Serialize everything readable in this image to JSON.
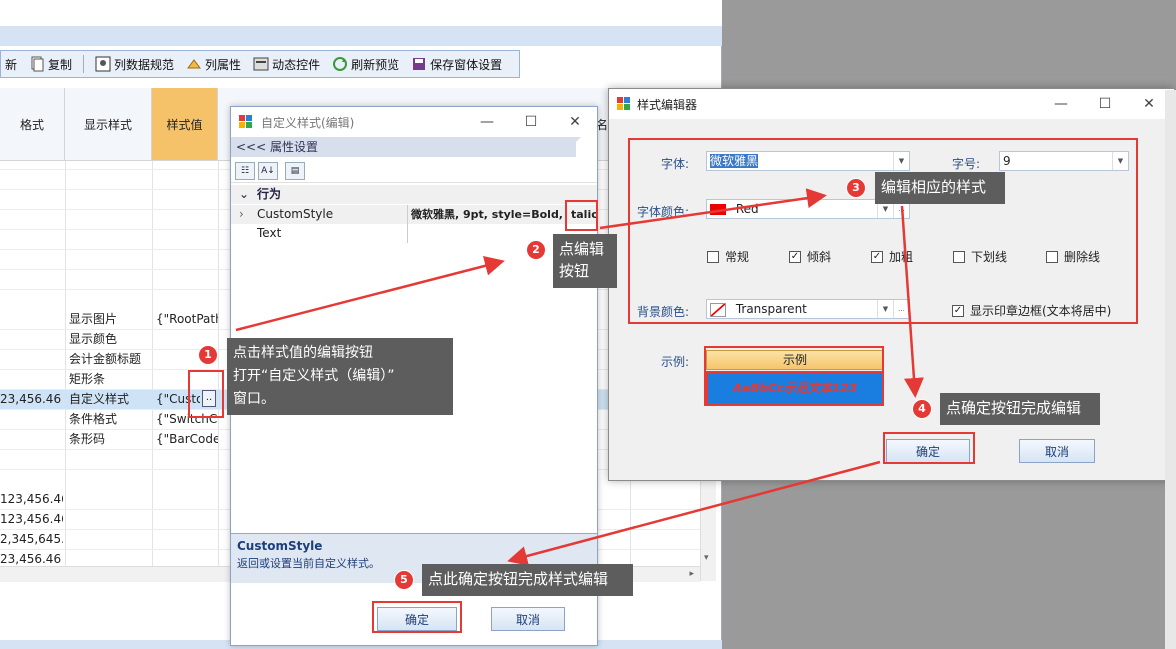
{
  "colors": {
    "accent_red": "#e53935",
    "callout_bg": "#5d5d5d",
    "sample_blue": "#1a7de0",
    "selected_column": "#f5c26a"
  },
  "main_toolbar": {
    "items": [
      {
        "label": "新",
        "icon": "refresh-icon"
      },
      {
        "label": "复制",
        "icon": "copy-icon"
      },
      {
        "label": "列数据规范",
        "icon": "column-rule-icon"
      },
      {
        "label": "列属性",
        "icon": "column-property-icon"
      },
      {
        "label": "动态控件",
        "icon": "dynamic-control-icon"
      },
      {
        "label": "刷新预览",
        "icon": "refresh-preview-icon"
      },
      {
        "label": "保存窗体设置",
        "icon": "save-icon"
      }
    ]
  },
  "grid": {
    "headers": [
      "格式",
      "显示样式",
      "样式值"
    ],
    "rows": [
      {
        "format": "",
        "style": "显示图片",
        "value": "{\"RootPath"
      },
      {
        "format": "",
        "style": "显示颜色",
        "value": ""
      },
      {
        "format": "",
        "style": "会计金额标题",
        "value": ""
      },
      {
        "format": "",
        "style": "矩形条",
        "value": ""
      },
      {
        "format": "23,456.46",
        "style": "自定义样式",
        "value": "{\"Custo",
        "ellipsis": ".."
      },
      {
        "format": "",
        "style": "条件格式",
        "value": "{\"SwitchC"
      },
      {
        "format": "",
        "style": "条形码",
        "value": "{\"BarCode"
      },
      {
        "format": "",
        "style": "",
        "value": ""
      },
      {
        "format": "123,456.46",
        "style": "",
        "value": ""
      },
      {
        "format": "123,456.46",
        "style": "",
        "value": ""
      },
      {
        "format": "2,345,645.6",
        "style": "",
        "value": ""
      },
      {
        "format": "23,456.46",
        "style": "",
        "value": ""
      }
    ],
    "cut_header": "名"
  },
  "custom_style_dialog": {
    "title": "自定义样式(编辑)",
    "header": "<<< 属性设置",
    "category": "行为",
    "properties": [
      {
        "name": "CustomStyle",
        "value": "微软雅黑, 9pt, style=Bold,",
        "value_tail": "talic"
      },
      {
        "name": "Text",
        "value": ""
      }
    ],
    "desc_title": "CustomStyle",
    "desc_text": "返回或设置当前自定义样式。",
    "ok": "确定",
    "cancel": "取消"
  },
  "style_editor": {
    "title": "样式编辑器",
    "font_label": "字体:",
    "font_value": "微软雅黑",
    "size_label": "字号:",
    "size_value": "9",
    "font_color_label": "字体颜色:",
    "font_color_value": "Red",
    "checks": [
      {
        "label": "常规",
        "checked": false
      },
      {
        "label": "倾斜",
        "checked": true
      },
      {
        "label": "加粗",
        "checked": true
      },
      {
        "label": "下划线",
        "checked": false
      },
      {
        "label": "删除线",
        "checked": false
      }
    ],
    "bg_color_label": "背景颜色:",
    "bg_color_value": "Transparent",
    "stamp_label": "显示印章边框(文本将居中)",
    "sample_label": "示例:",
    "sample_head": "示例",
    "sample_text": "AaBbCc示范文本123",
    "ok": "确定",
    "cancel": "取消"
  },
  "callouts": [
    {
      "num": "1",
      "text_line1": "点击样式值的编辑按钮",
      "text_line2": "打开“自定义样式（编辑）”",
      "text_line3": "窗口。"
    },
    {
      "num": "2",
      "text_line1": "点编辑",
      "text_line2": "按钮"
    },
    {
      "num": "3",
      "text_line1": "编辑相应的样式"
    },
    {
      "num": "4",
      "text_line1": "点确定按钮完成编辑"
    },
    {
      "num": "5",
      "text_line1": "点此确定按钮完成样式编辑"
    }
  ]
}
